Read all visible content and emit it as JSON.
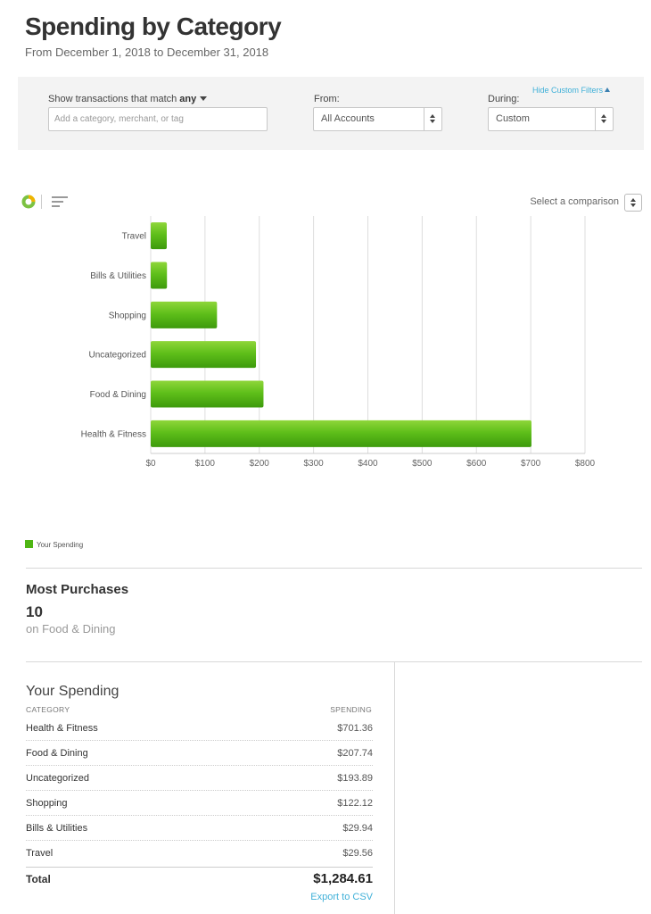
{
  "header": {
    "title": "Spending by Category",
    "subtitle": "From December 1, 2018 to December 31, 2018"
  },
  "filters": {
    "hide_label": "Hide Custom Filters",
    "match_label": "Show transactions that match",
    "match_value": "any",
    "search_placeholder": "Add a category, merchant, or tag",
    "search_value": "",
    "from_label": "From:",
    "from_value": "All Accounts",
    "during_label": "During:",
    "during_value": "Custom"
  },
  "chart_controls": {
    "donut_icon": "donut-chart-icon",
    "bars_icon": "bar-chart-icon",
    "comparison_label": "Select a comparison"
  },
  "chart_data": {
    "type": "bar",
    "orientation": "horizontal",
    "categories": [
      "Travel",
      "Bills & Utilities",
      "Shopping",
      "Uncategorized",
      "Food & Dining",
      "Health & Fitness"
    ],
    "series": [
      {
        "name": "Your Spending",
        "values": [
          29.56,
          29.94,
          122.12,
          193.89,
          207.74,
          701.36
        ]
      }
    ],
    "xlim": [
      0,
      800
    ],
    "xticks": [
      0,
      100,
      200,
      300,
      400,
      500,
      600,
      700,
      800
    ],
    "xtick_labels": [
      "$0",
      "$100",
      "$200",
      "$300",
      "$400",
      "$500",
      "$600",
      "$700",
      "$800"
    ],
    "grid": true,
    "bar_color": "#4fb614",
    "legend_position": "bottom-left"
  },
  "legend": {
    "label": "Your Spending"
  },
  "most_purchases": {
    "title": "Most Purchases",
    "count": "10",
    "subtitle": "on Food & Dining"
  },
  "your_spending": {
    "title": "Your Spending",
    "col_category": "CATEGORY",
    "col_spending": "SPENDING",
    "rows": [
      {
        "category": "Health & Fitness",
        "amount": "$701.36"
      },
      {
        "category": "Food & Dining",
        "amount": "$207.74"
      },
      {
        "category": "Uncategorized",
        "amount": "$193.89"
      },
      {
        "category": "Shopping",
        "amount": "$122.12"
      },
      {
        "category": "Bills & Utilities",
        "amount": "$29.94"
      },
      {
        "category": "Travel",
        "amount": "$29.56"
      }
    ],
    "total_label": "Total",
    "total_amount": "$1,284.61",
    "export_label": "Export to CSV"
  },
  "colors": {
    "accent_link": "#3fb0d8",
    "bar_green": "#4fb614",
    "panel_bg": "#f3f3f3"
  }
}
